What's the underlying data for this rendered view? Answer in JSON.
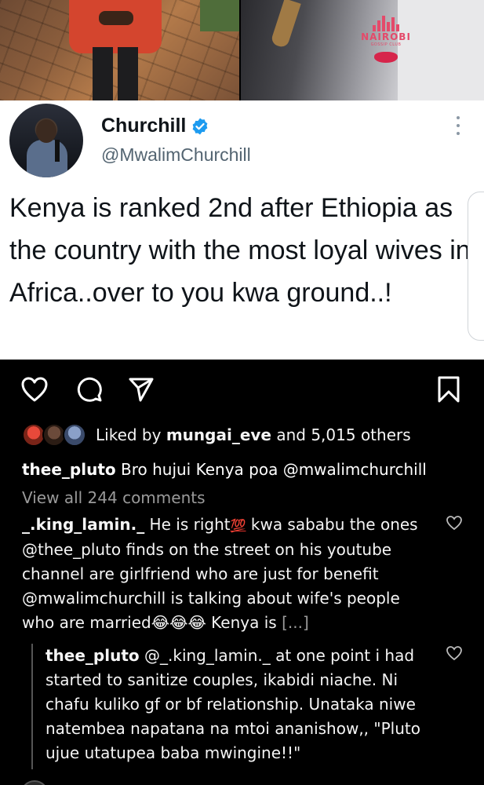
{
  "photos": {
    "logo_name": "NAIROBI",
    "logo_sub": "GOSSIP CLUB"
  },
  "tweet": {
    "name": "Churchill",
    "handle": "@MwalimChurchill",
    "text": "Kenya is ranked 2nd after Ethiopia as the country with the most loyal wives in Africa..over to you kwa ground..!",
    "verified_color": "#1d9bf0"
  },
  "actions": {
    "icons": [
      "heart-icon",
      "comment-icon",
      "send-icon",
      "bookmark-icon"
    ]
  },
  "likes": {
    "prefix": "Liked by ",
    "user": "mungai_eve",
    "suffix": " and 5,015 others"
  },
  "caption": {
    "user": "thee_pluto",
    "text": " Bro hujui Kenya poa @mwalimchurchill"
  },
  "view_all": "View all 244 comments",
  "comments": [
    {
      "user": "_.king_lamin._",
      "text_a": " He is right",
      "badge": "💯",
      "text_b": " kwa sababu the ones @thee_pluto finds on the street on his youtube channel are girlfriend who are just for benefit @mwalimchurchill is talking about wife's people who are  married",
      "emoji": "😂😂😂",
      "text_c": " Kenya is ",
      "more": "[...]"
    },
    {
      "user": "thee_pluto",
      "text": " @_.king_lamin._ at one point i had started to sanitize couples, ikabidi niache. Ni chafu kuliko gf or bf relationship. Unataka niwe natembea napatana na mtoi ananishow,, \"Pluto ujue utatupea baba mwingine!!\""
    }
  ]
}
